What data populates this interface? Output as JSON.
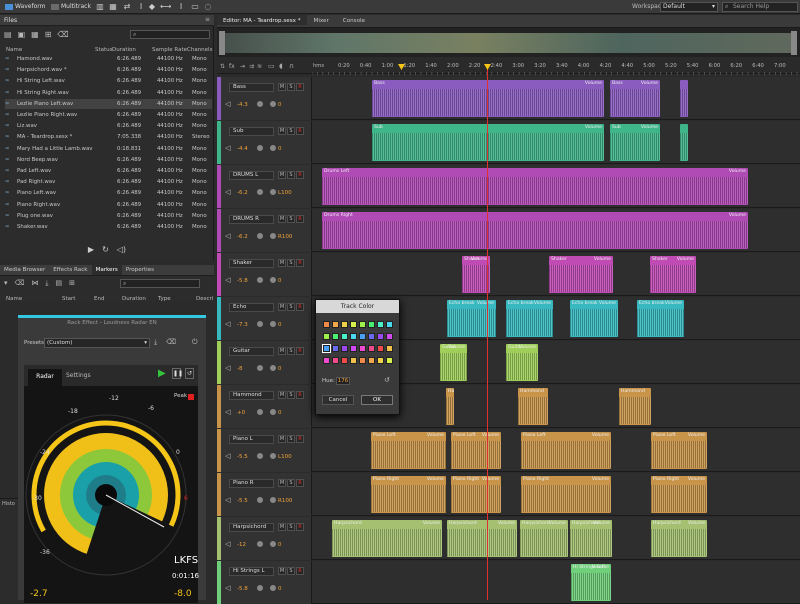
{
  "topbar": {
    "waveform_tab": "Waveform",
    "multitrack_tab": "Multitrack",
    "workspace_label": "Workspace:",
    "workspace_value": "Default",
    "search_placeholder": "Search Help"
  },
  "files": {
    "panel_title": "Files",
    "columns": {
      "name": "Name",
      "status": "Status",
      "duration": "Duration",
      "sample_rate": "Sample Rate",
      "channels": "Channels"
    },
    "rows": [
      {
        "name": "Hamond.wav",
        "status": "",
        "duration": "6:26.489",
        "rate": "44100 Hz",
        "channels": "Mono"
      },
      {
        "name": "Harpsichord.wav *",
        "status": "",
        "duration": "6:26.489",
        "rate": "44100 Hz",
        "channels": "Mono"
      },
      {
        "name": "Hi String Left.wav",
        "status": "",
        "duration": "6:26.489",
        "rate": "44100 Hz",
        "channels": "Mono"
      },
      {
        "name": "Hi String Right.wav",
        "status": "",
        "duration": "6:26.489",
        "rate": "44100 Hz",
        "channels": "Mono"
      },
      {
        "name": "Lezlie Piano Left.wav",
        "status": "",
        "duration": "6:26.489",
        "rate": "44100 Hz",
        "channels": "Mono"
      },
      {
        "name": "Lezlie Piano Right.wav",
        "status": "",
        "duration": "6:26.489",
        "rate": "44100 Hz",
        "channels": "Mono"
      },
      {
        "name": "Liz.wav",
        "status": "",
        "duration": "6:26.489",
        "rate": "44100 Hz",
        "channels": "Mono"
      },
      {
        "name": "MA - Teardrop.sesx *",
        "status": "",
        "duration": "7:05.338",
        "rate": "44100 Hz",
        "channels": "Stereo"
      },
      {
        "name": "Mary Had a Little Lamb.wav",
        "status": "",
        "duration": "0:18.831",
        "rate": "44100 Hz",
        "channels": "Mono"
      },
      {
        "name": "Nord Beep.wav",
        "status": "",
        "duration": "6:26.489",
        "rate": "44100 Hz",
        "channels": "Mono"
      },
      {
        "name": "Pad Left.wav",
        "status": "",
        "duration": "6:26.489",
        "rate": "44100 Hz",
        "channels": "Mono"
      },
      {
        "name": "Pad Right.wav",
        "status": "",
        "duration": "6:26.489",
        "rate": "44100 Hz",
        "channels": "Mono"
      },
      {
        "name": "Piano Left.wav",
        "status": "",
        "duration": "6:26.489",
        "rate": "44100 Hz",
        "channels": "Mono"
      },
      {
        "name": "Piano Right.wav",
        "status": "",
        "duration": "6:26.489",
        "rate": "44100 Hz",
        "channels": "Mono"
      },
      {
        "name": "Plug one.wav",
        "status": "",
        "duration": "6:26.489",
        "rate": "44100 Hz",
        "channels": "Mono"
      },
      {
        "name": "Shaker.wav",
        "status": "",
        "duration": "6:26.489",
        "rate": "44100 Hz",
        "channels": "Mono"
      }
    ]
  },
  "markers": {
    "tabs": [
      "Media Browser",
      "Effects Rack",
      "Markers",
      "Properties"
    ],
    "columns": {
      "name": "Name",
      "start": "Start",
      "end": "End",
      "duration": "Duration",
      "type": "Type",
      "desc": "Descri"
    }
  },
  "rack": {
    "title": "Rack Effect - Loudness Radar EN",
    "presets_label": "Presets:",
    "preset_value": "(Custom)",
    "tabs": [
      "Radar",
      "Settings"
    ],
    "peak_label": "Peak",
    "scale": [
      "-12",
      "-6",
      "-18",
      "-24",
      "0",
      "-30",
      "6",
      "-36"
    ],
    "lkfs_label": "LKFS",
    "time": "0:01:16",
    "left_value": "-2.7",
    "right_value": "-8.0",
    "accent": "#f5c518"
  },
  "side_tab": "Histo",
  "editor": {
    "tabs": [
      "Editor: MA - Teardrop.sesx *",
      "Mixer",
      "Console"
    ],
    "hms": "hms",
    "ruler": [
      "0:20",
      "0:40",
      "1:00",
      "1:20",
      "1:40",
      "2:00",
      "2:20",
      "2:40",
      "3:00",
      "3:20",
      "3:40",
      "4:00",
      "4:20",
      "4:40",
      "5:00",
      "5:20",
      "5:40",
      "6:00",
      "6:20",
      "6:40",
      "7:00"
    ],
    "tracks": [
      {
        "name": "Bass",
        "vol": "-4.3",
        "pan": "0",
        "color": "#8a5cc0",
        "clips": [
          {
            "label": "Bass",
            "vol": "Volume"
          },
          {
            "label": "Bass",
            "vol": "Volume"
          },
          {
            "label": "",
            "vol": ""
          }
        ]
      },
      {
        "name": "Sub",
        "vol": "-4.4",
        "pan": "0",
        "color": "#3fb58a",
        "clips": [
          {
            "label": "Sub",
            "vol": "Volume"
          },
          {
            "label": "Sub",
            "vol": "Volume"
          },
          {
            "label": "",
            "vol": ""
          }
        ]
      },
      {
        "name": "DRUMS L",
        "vol": "-6.2",
        "pan": "L100",
        "color": "#b04ab5",
        "clips": [
          {
            "label": "Drums Left",
            "vol": "Volume"
          }
        ]
      },
      {
        "name": "DRUMS R",
        "vol": "-6.2",
        "pan": "R100",
        "color": "#b04ab5",
        "clips": [
          {
            "label": "Drums Right",
            "vol": "Volume"
          }
        ]
      },
      {
        "name": "Shaker",
        "vol": "-5.8",
        "pan": "0",
        "color": "#c04bb5",
        "clips": [
          {
            "label": "Shaker",
            "vol": "Volume"
          },
          {
            "label": "Shaker",
            "vol": "Volume"
          },
          {
            "label": "Shaker",
            "vol": "Volume"
          }
        ]
      },
      {
        "name": "Echo",
        "vol": "-7.3",
        "pan": "0",
        "color": "#38b9c0",
        "clips": [
          {
            "label": "Echo break",
            "vol": "Volume"
          },
          {
            "label": "Echo break",
            "vol": "Volume"
          },
          {
            "label": "Echo break",
            "vol": "Volume"
          },
          {
            "label": "Echo break",
            "vol": "Volume"
          }
        ]
      },
      {
        "name": "Guitar",
        "vol": "-8",
        "pan": "0",
        "color": "#9fcf5a",
        "clips": [
          {
            "label": "Guitar",
            "vol": "Volume"
          },
          {
            "label": "Guitar",
            "vol": "Volume"
          }
        ]
      },
      {
        "name": "Hammond",
        "vol": "+0",
        "pan": "0",
        "color": "#c8944a",
        "clips": [
          {
            "label": "Hammond",
            "vol": ""
          },
          {
            "label": "Hammond",
            "vol": ""
          },
          {
            "label": "Hammond",
            "vol": ""
          }
        ]
      },
      {
        "name": "Piano L",
        "vol": "-5.5",
        "pan": "L100",
        "color": "#c8944a",
        "clips": [
          {
            "label": "Piano Left",
            "vol": "Volume"
          },
          {
            "label": "Piano Left",
            "vol": "Volume"
          },
          {
            "label": "Piano Left",
            "vol": "Volume"
          },
          {
            "label": "Piano Left",
            "vol": "Volume"
          }
        ]
      },
      {
        "name": "Piano R",
        "vol": "-5.5",
        "pan": "R100",
        "color": "#c8944a",
        "clips": [
          {
            "label": "Piano Right",
            "vol": "Volume"
          },
          {
            "label": "Piano Right",
            "vol": "Volume"
          },
          {
            "label": "Piano Right",
            "vol": "Volume"
          },
          {
            "label": "Piano Right",
            "vol": "Volume"
          }
        ]
      },
      {
        "name": "Harpsichord",
        "vol": "-12",
        "pan": "0",
        "color": "#a4c070",
        "clips": [
          {
            "label": "Harpsichord",
            "vol": "Volume"
          },
          {
            "label": "Harpsichord",
            "vol": "Volume"
          },
          {
            "label": "Harpsichord",
            "vol": "Volume"
          },
          {
            "label": "Harpsichord",
            "vol": "Volume"
          }
        ]
      },
      {
        "name": "Hi Strings L",
        "vol": "-5.8",
        "pan": "0",
        "color": "#6fcf7a",
        "clips": [
          {
            "label": "Hi Strings Left",
            "vol": "Volume"
          }
        ]
      }
    ]
  },
  "track_color": {
    "title": "Track Color",
    "hue_label": "Hue:",
    "hue_value": "176",
    "cancel": "Cancel",
    "ok": "OK"
  }
}
